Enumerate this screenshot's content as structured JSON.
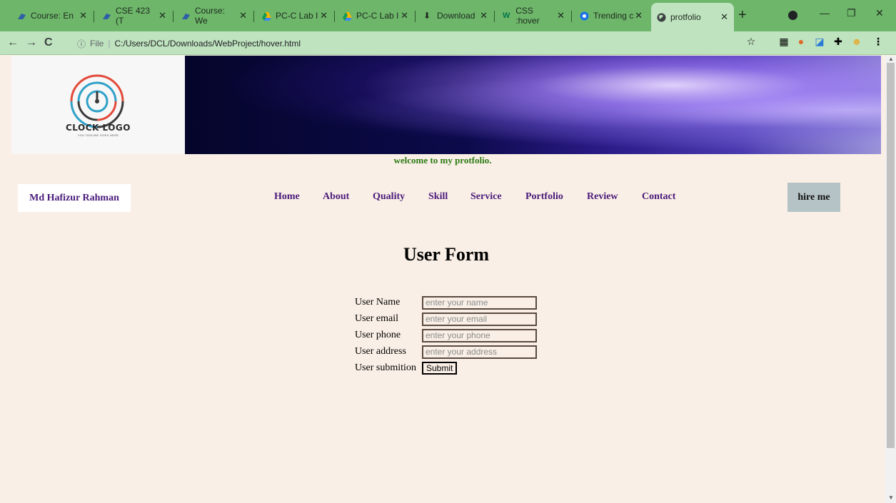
{
  "browser": {
    "tabs": [
      {
        "title": "Course: En",
        "icon": "moodle-icon"
      },
      {
        "title": "CSE 423 (T",
        "icon": "moodle-icon"
      },
      {
        "title": "Course: We",
        "icon": "moodle-icon"
      },
      {
        "title": "PC-C Lab I",
        "icon": "drive-icon"
      },
      {
        "title": "PC-C Lab I",
        "icon": "drive-icon"
      },
      {
        "title": "Download",
        "icon": "download-icon"
      },
      {
        "title": "CSS :hover",
        "icon": "w3schools-icon"
      },
      {
        "title": "Trending c",
        "icon": "trending-icon"
      },
      {
        "title": "protfolio",
        "icon": "globe-icon"
      }
    ],
    "address": {
      "scheme_label": "File",
      "url": "C:/Users/DCL/Downloads/WebProject/hover.html"
    }
  },
  "header": {
    "logo_text": "CLOCK LOGO",
    "logo_tagline": "YOU TAGLINE GOES HERE",
    "welcome": "welcome to my protfolio."
  },
  "nav": {
    "name": "Md Hafizur Rahman",
    "items": [
      "Home",
      "About",
      "Quality",
      "Skill",
      "Service",
      "Portfolio",
      "Review",
      "Contact"
    ],
    "hire": "hire me"
  },
  "form": {
    "title": "User Form",
    "fields": [
      {
        "label": "User Name",
        "placeholder": "enter your name"
      },
      {
        "label": "User email",
        "placeholder": "enter your email"
      },
      {
        "label": "User phone",
        "placeholder": "enter your phone"
      },
      {
        "label": "User address",
        "placeholder": "enter your address"
      }
    ],
    "submit_label": "User submition",
    "submit_button": "Submit"
  },
  "colors": {
    "page_bg": "#f9efe6",
    "nav_text": "#4a1a7a",
    "welcome_text": "#2a7a12",
    "hire_bg": "#b6c3c6"
  }
}
